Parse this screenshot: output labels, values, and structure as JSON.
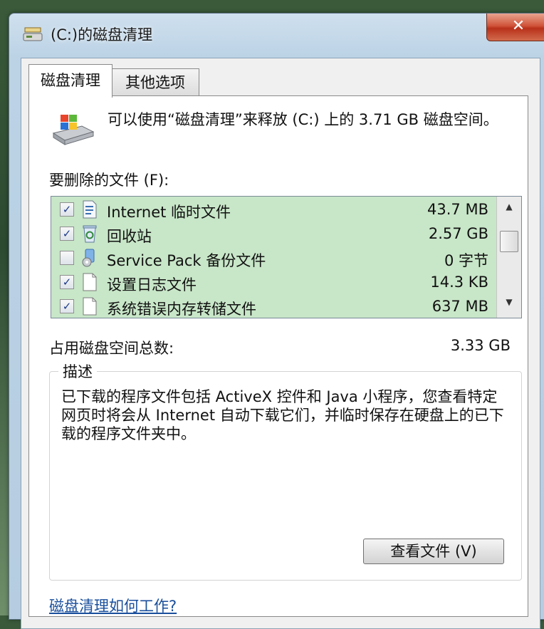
{
  "window": {
    "title": "(C:)的磁盘清理",
    "close_label": "✕"
  },
  "tabs": [
    {
      "label": "磁盘清理",
      "active": true
    },
    {
      "label": "其他选项",
      "active": false
    }
  ],
  "intro": {
    "text": "可以使用“磁盘清理”来释放 (C:) 上的 3.71 GB 磁盘空间。"
  },
  "files": {
    "label": "要删除的文件 (F):",
    "items": [
      {
        "checked": true,
        "icon": "document-icon",
        "name": "Internet 临时文件",
        "size": "43.7 MB"
      },
      {
        "checked": true,
        "icon": "recycle-bin-icon",
        "name": "回收站",
        "size": "2.57 GB"
      },
      {
        "checked": false,
        "icon": "service-pack-icon",
        "name": "Service Pack 备份文件",
        "size": "0 字节"
      },
      {
        "checked": true,
        "icon": "blank-file-icon",
        "name": "设置日志文件",
        "size": "14.3 KB"
      },
      {
        "checked": true,
        "icon": "blank-file-icon",
        "name": "系统错误内存转储文件",
        "size": "637 MB"
      }
    ],
    "list_background": "#c8e6c8"
  },
  "total": {
    "label": "占用磁盘空间总数:",
    "value": "3.33 GB"
  },
  "description": {
    "legend": "描述",
    "text": "已下载的程序文件包括 ActiveX 控件和 Java 小程序，您查看特定网页时将会从 Internet 自动下载它们，并临时保存在硬盘上的已下载的程序文件夹中。",
    "view_button": "查看文件 (V)"
  },
  "help_link": "磁盘清理如何工作?"
}
